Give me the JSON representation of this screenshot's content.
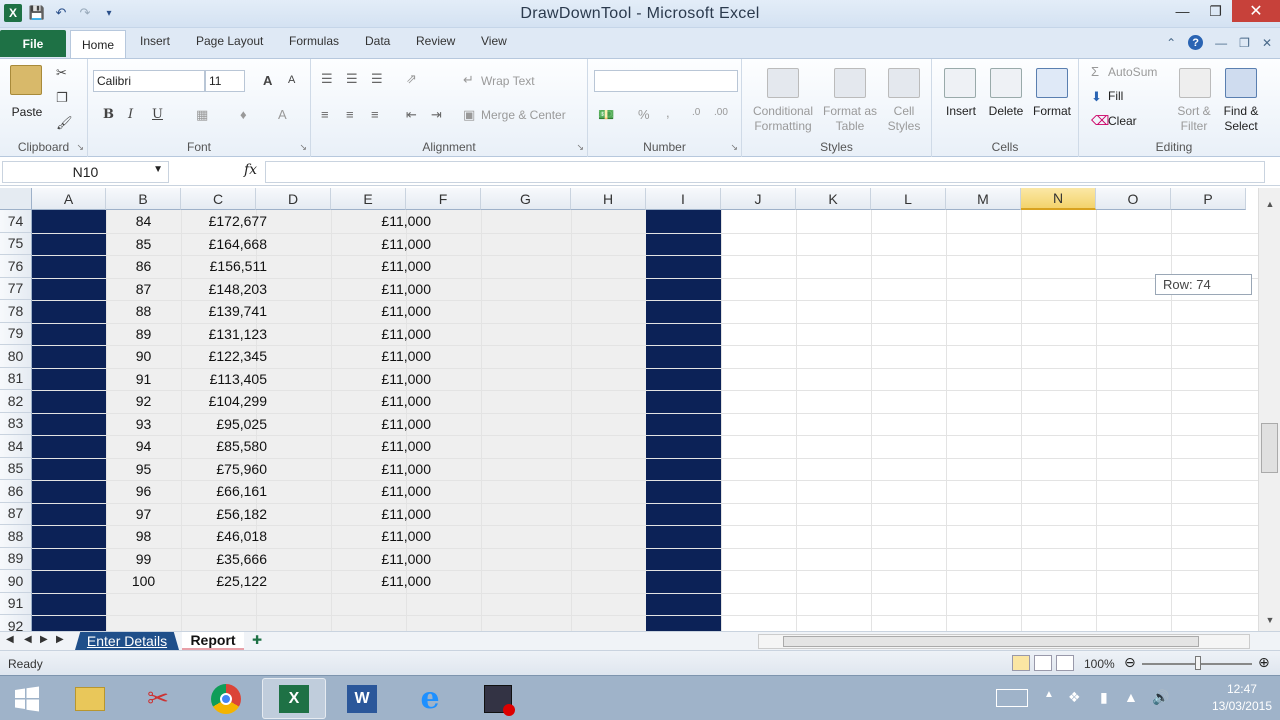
{
  "window": {
    "title": "DrawDownTool  -  Microsoft Excel",
    "app_letter": "X"
  },
  "tabs": [
    "File",
    "Home",
    "Insert",
    "Page Layout",
    "Formulas",
    "Data",
    "Review",
    "View"
  ],
  "ribbon": {
    "clipboard": {
      "label": "Clipboard",
      "paste": "Paste"
    },
    "font": {
      "label": "Font",
      "name": "Calibri",
      "size": "11",
      "bold": "B",
      "italic": "I",
      "underline": "U",
      "grow": "A",
      "shrink": "A",
      "fontcolor": "A"
    },
    "alignment": {
      "label": "Alignment",
      "wrap": "Wrap Text",
      "merge": "Merge & Center"
    },
    "number": {
      "label": "Number",
      "format": "",
      "percent": "%",
      "comma": ","
    },
    "styles": {
      "label": "Styles",
      "conditional": [
        "Conditional",
        "Formatting"
      ],
      "format_table": [
        "Format as",
        "Table"
      ],
      "cell_styles": [
        "Cell",
        "Styles"
      ]
    },
    "cells": {
      "label": "Cells",
      "insert": "Insert",
      "delete": "Delete",
      "format": "Format"
    },
    "editing": {
      "label": "Editing",
      "autosum": "AutoSum",
      "fill": "Fill",
      "clear": "Clear",
      "sort": [
        "Sort &",
        "Filter"
      ],
      "find": [
        "Find &",
        "Select"
      ],
      "sigma": "Σ"
    }
  },
  "formula_bar": {
    "name_box": "N10",
    "fx": "fx",
    "formula": ""
  },
  "columns": [
    "A",
    "B",
    "C",
    "D",
    "E",
    "F",
    "G",
    "H",
    "I",
    "J",
    "K",
    "L",
    "M",
    "N",
    "O",
    "P"
  ],
  "selected_column": "N",
  "rows": [
    {
      "n": "74",
      "b": "84",
      "c": "£172,677",
      "e": "£11,000"
    },
    {
      "n": "75",
      "b": "85",
      "c": "£164,668",
      "e": "£11,000"
    },
    {
      "n": "76",
      "b": "86",
      "c": "£156,511",
      "e": "£11,000"
    },
    {
      "n": "77",
      "b": "87",
      "c": "£148,203",
      "e": "£11,000"
    },
    {
      "n": "78",
      "b": "88",
      "c": "£139,741",
      "e": "£11,000"
    },
    {
      "n": "79",
      "b": "89",
      "c": "£131,123",
      "e": "£11,000"
    },
    {
      "n": "80",
      "b": "90",
      "c": "£122,345",
      "e": "£11,000"
    },
    {
      "n": "81",
      "b": "91",
      "c": "£113,405",
      "e": "£11,000"
    },
    {
      "n": "82",
      "b": "92",
      "c": "£104,299",
      "e": "£11,000"
    },
    {
      "n": "83",
      "b": "93",
      "c": "£95,025",
      "e": "£11,000"
    },
    {
      "n": "84",
      "b": "94",
      "c": "£85,580",
      "e": "£11,000"
    },
    {
      "n": "85",
      "b": "95",
      "c": "£75,960",
      "e": "£11,000"
    },
    {
      "n": "86",
      "b": "96",
      "c": "£66,161",
      "e": "£11,000"
    },
    {
      "n": "87",
      "b": "97",
      "c": "£56,182",
      "e": "£11,000"
    },
    {
      "n": "88",
      "b": "98",
      "c": "£46,018",
      "e": "£11,000"
    },
    {
      "n": "89",
      "b": "99",
      "c": "£35,666",
      "e": "£11,000"
    },
    {
      "n": "90",
      "b": "100",
      "c": "£25,122",
      "e": "£11,000"
    },
    {
      "n": "91",
      "b": "",
      "c": "",
      "e": ""
    },
    {
      "n": "92",
      "b": "",
      "c": "",
      "e": ""
    }
  ],
  "tooltip": "Row: 74",
  "sheets": {
    "tabs": [
      "Enter Details",
      "Report"
    ],
    "active": "Report"
  },
  "status": {
    "ready": "Ready",
    "zoom": "100%"
  },
  "taskbar": {
    "time": "12:47",
    "date": "13/03/2015"
  },
  "colors": {
    "navy": "#0c2257",
    "excel_green": "#1e7145",
    "close_red": "#c7413a",
    "selected_header": "#f3d36c"
  }
}
